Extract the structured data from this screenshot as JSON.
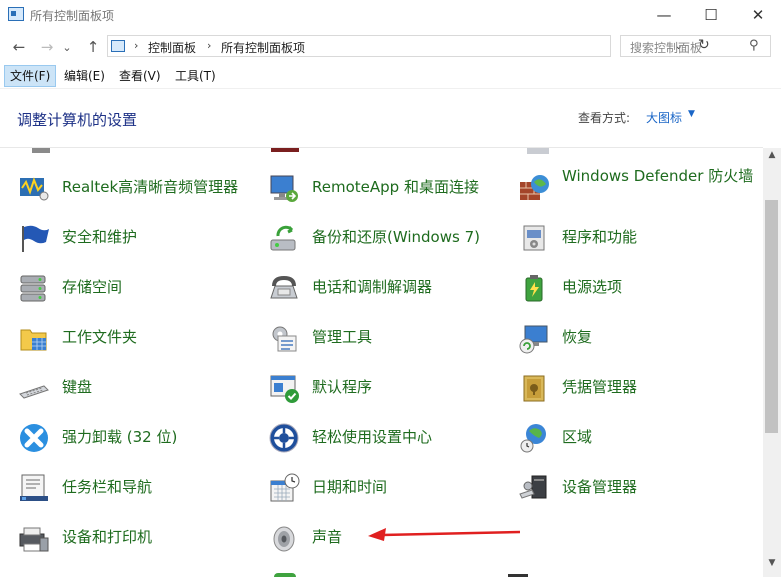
{
  "window": {
    "title": "所有控制面板项",
    "minimize": "—",
    "maximize": "☐",
    "close": "✕"
  },
  "nav": {
    "back": "←",
    "forward": "→",
    "recent": "⌄",
    "up": "↑",
    "breadcrumb": [
      "控制面板",
      "所有控制面板项"
    ],
    "separator": "›",
    "dropdown": "⌄",
    "refresh": "↻",
    "search_placeholder": "搜索控制面板",
    "search_icon": "⚲"
  },
  "menu": [
    "文件(F)",
    "编辑(E)",
    "查看(V)",
    "工具(T)"
  ],
  "header": {
    "title": "调整计算机的设置",
    "view_label": "查看方式:",
    "view_value": "大图标",
    "view_caret": "▼"
  },
  "items": [
    {
      "label": "Realtek高清晰音频管理器",
      "icon": "realtek-audio-icon"
    },
    {
      "label": "RemoteApp 和桌面连接",
      "icon": "remoteapp-icon"
    },
    {
      "label": "Windows Defender 防火墙",
      "icon": "firewall-icon"
    },
    {
      "label": "安全和维护",
      "icon": "security-flag-icon"
    },
    {
      "label": "备份和还原(Windows 7)",
      "icon": "backup-restore-icon"
    },
    {
      "label": "程序和功能",
      "icon": "programs-icon"
    },
    {
      "label": "存储空间",
      "icon": "storage-spaces-icon"
    },
    {
      "label": "电话和调制解调器",
      "icon": "phone-modem-icon"
    },
    {
      "label": "电源选项",
      "icon": "power-options-icon"
    },
    {
      "label": "工作文件夹",
      "icon": "work-folders-icon"
    },
    {
      "label": "管理工具",
      "icon": "admin-tools-icon"
    },
    {
      "label": "恢复",
      "icon": "recovery-icon"
    },
    {
      "label": "键盘",
      "icon": "keyboard-icon"
    },
    {
      "label": "默认程序",
      "icon": "default-programs-icon"
    },
    {
      "label": "凭据管理器",
      "icon": "credential-manager-icon"
    },
    {
      "label": "强力卸载 (32 位)",
      "icon": "uninstaller-icon"
    },
    {
      "label": "轻松使用设置中心",
      "icon": "ease-of-access-icon"
    },
    {
      "label": "区域",
      "icon": "region-icon"
    },
    {
      "label": "任务栏和导航",
      "icon": "taskbar-icon"
    },
    {
      "label": "日期和时间",
      "icon": "date-time-icon"
    },
    {
      "label": "设备管理器",
      "icon": "device-manager-icon"
    },
    {
      "label": "设备和打印机",
      "icon": "devices-printers-icon"
    },
    {
      "label": "声音",
      "icon": "sound-icon"
    }
  ],
  "scroll": {
    "up": "▲",
    "down": "▼"
  },
  "annotation": {
    "color": "#e02020"
  }
}
